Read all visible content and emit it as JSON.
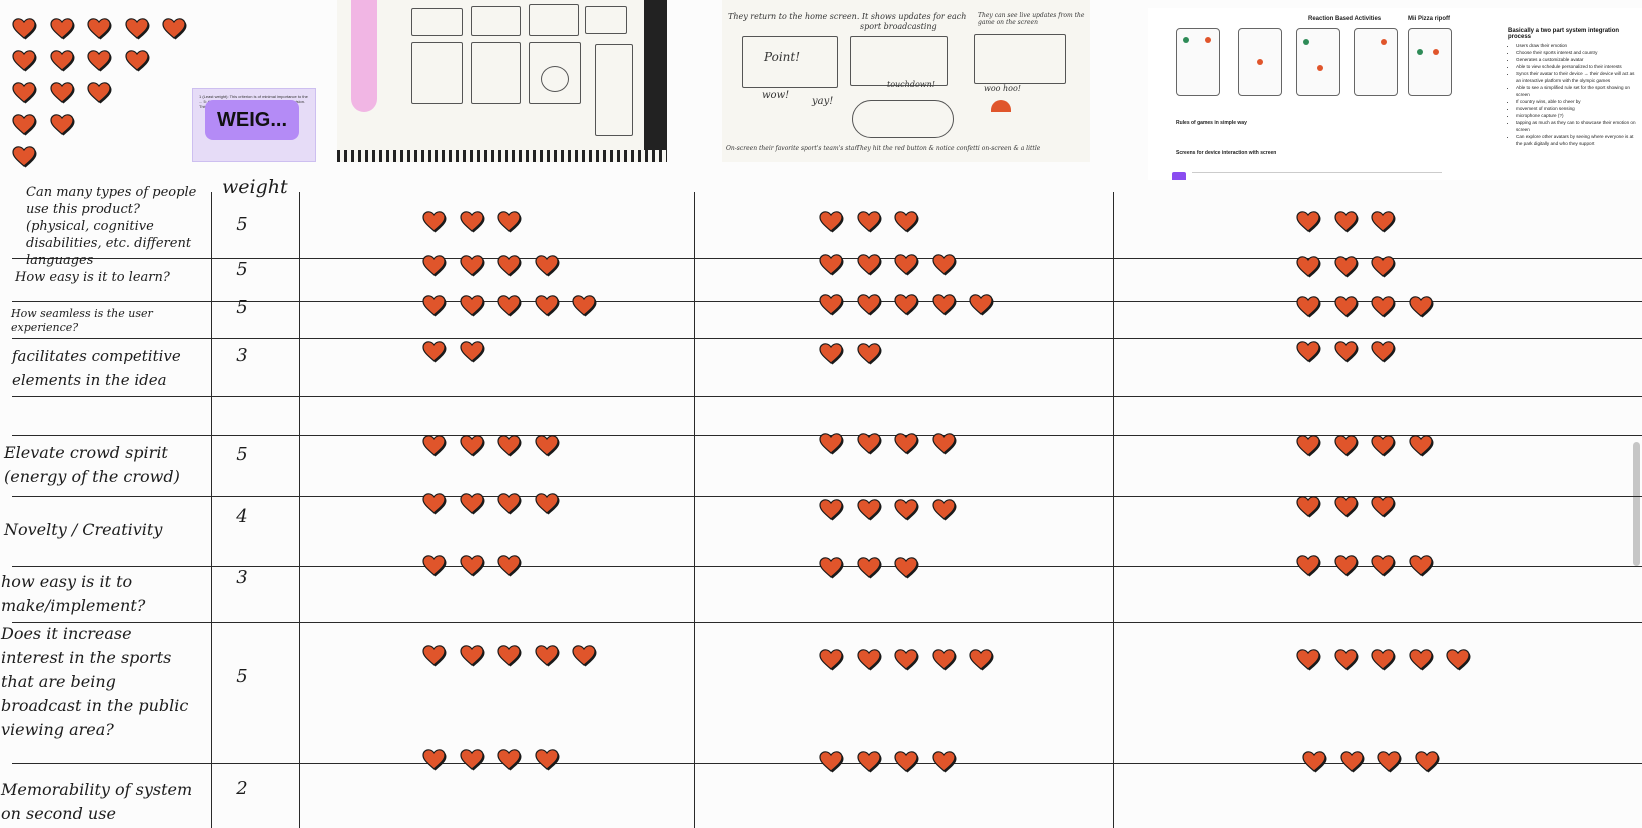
{
  "colors": {
    "heart": "#e0552b",
    "heart_outline": "#1a1a1a",
    "badge": "#b48bf6",
    "sticky": "#e6dcf7"
  },
  "icons": {
    "heart": "heart-icon"
  },
  "legend_hearts": [
    5,
    4,
    3,
    2,
    1
  ],
  "sticky_note": {
    "badge": "WEIG...",
    "text": "1 (Least weight): This criterion is of minimal importance to the ... 5: the criterion is critical and heavily impacts the decision. This is often a key factor in the final outcome."
  },
  "sketches": {
    "sketch_2_lines": [
      "They return to the home screen. It shows updates for each",
      "sport broadcasting",
      "They can see live updates from the game on the screen",
      "Point!",
      "wow!",
      "yay!",
      "touchdown!",
      "woo hoo!",
      "They hit the red button & notice confetti on-screen & a little",
      "On-screen their favorite sport's team's star"
    ]
  },
  "design_frame": {
    "labels": [
      "Reaction Based Activities",
      "Mii Pizza ripoff",
      "Rules of games in simple way",
      "Screens for device interaction with screen"
    ],
    "bullet_title": "Basically a two part system integration process",
    "bullets": [
      "Users draw their emotion",
      "Choose their sports interest and country",
      "Generates a customizable avatar",
      "Able to view schedule personalized to their interests",
      "Syncs their avatar to their device → their device will act as an interactive platform with the olympic games",
      "Able to see a simplified rule set for the sport showing on screen",
      "If country wins, able to cheer by",
      "movement of motion sensing",
      "microphone capture (?)",
      "tapping as much as they can to showcase their emotion on screen",
      "Can explore other avatars by seeing where everyone is at the park digitally and who they support"
    ]
  },
  "table": {
    "weight_header": "weight",
    "rows": [
      {
        "criterion": "Can many types of people use this product? (physical, cognitive disabilities, etc. different languages",
        "weight": "5",
        "scores": [
          3,
          3,
          3
        ]
      },
      {
        "criterion": "How easy is it to learn?",
        "weight": "5",
        "scores": [
          4,
          4,
          3
        ]
      },
      {
        "criterion": "How seamless is the user experience?",
        "weight": "5",
        "scores": [
          5,
          5,
          4
        ]
      },
      {
        "criterion": "facilitates competitive elements in the idea",
        "weight": "3",
        "scores": [
          2,
          2,
          3
        ]
      },
      {
        "criterion": "",
        "weight": "",
        "scores": [
          0,
          0,
          0
        ]
      },
      {
        "criterion": "Elevate crowd spirit (energy of the crowd)",
        "weight": "5",
        "scores": [
          4,
          4,
          4
        ]
      },
      {
        "criterion": "Novelty / Creativity",
        "weight": "4",
        "scores": [
          4,
          4,
          3
        ]
      },
      {
        "criterion": "how easy is it to make/implement?",
        "weight": "3",
        "scores": [
          3,
          3,
          4
        ]
      },
      {
        "criterion": "Does it increase interest in the sports that are being broadcast in the public viewing area?",
        "weight": "5",
        "scores": [
          5,
          5,
          5
        ]
      },
      {
        "criterion": "Memorability of system on second use",
        "weight": "2",
        "scores": [
          4,
          4,
          4
        ]
      }
    ]
  }
}
